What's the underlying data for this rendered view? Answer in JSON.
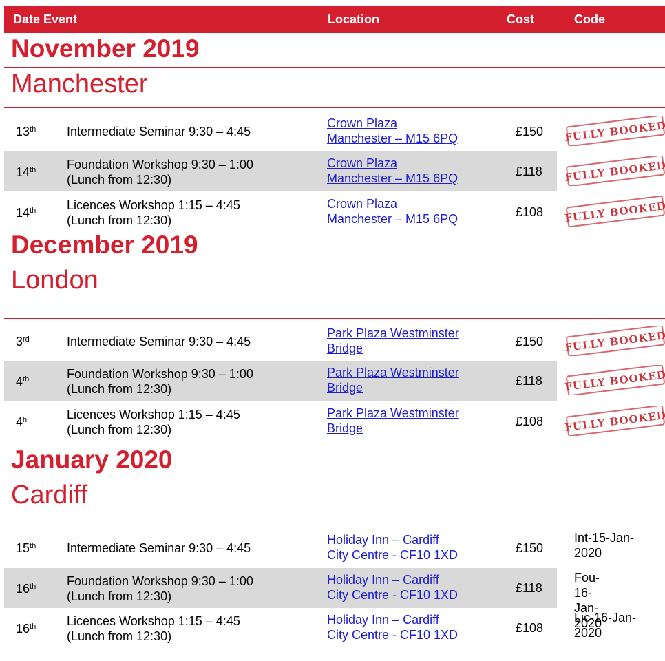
{
  "header": {
    "date_event": "Date Event",
    "location": "Location",
    "cost": "Cost",
    "code": "Code"
  },
  "colors": {
    "brand_red": "#d31f2e",
    "row_shade": "#d9d9d9",
    "link_blue": "#1f1fd0"
  },
  "stamp_text": "FULLY BOOKED",
  "sections": [
    {
      "month": "November 2019",
      "city": "Manchester",
      "rows": [
        {
          "day": "13",
          "suffix": "th",
          "event": [
            "Intermediate Seminar 9:30 – 4:45"
          ],
          "location": [
            "Crown Plaza",
            "Manchester – M15 6PQ"
          ],
          "cost": "£150",
          "status": "FULLY BOOKED"
        },
        {
          "day": "14",
          "suffix": "th",
          "event": [
            "Foundation Workshop 9:30 – 1:00",
            "(Lunch from 12:30)"
          ],
          "location": [
            "Crown Plaza",
            "Manchester – M15 6PQ"
          ],
          "cost": "£118",
          "status": "FULLY BOOKED"
        },
        {
          "day": "14",
          "suffix": "th",
          "event": [
            "Licences Workshop 1:15 – 4:45",
            "(Lunch from 12:30)"
          ],
          "location": [
            "Crown Plaza",
            "Manchester – M15 6PQ"
          ],
          "cost": "£108",
          "status": "FULLY BOOKED"
        }
      ]
    },
    {
      "month": "December 2019",
      "city": "London",
      "rows": [
        {
          "day": "3",
          "suffix": "rd",
          "event": [
            "Intermediate Seminar 9:30 – 4:45"
          ],
          "location": [
            "Park Plaza Westminster",
            "Bridge"
          ],
          "cost": "£150",
          "status": "FULLY BOOKED"
        },
        {
          "day": "4",
          "suffix": "th",
          "event": [
            "Foundation Workshop 9:30 – 1:00",
            "(Lunch from 12:30)"
          ],
          "location": [
            "Park Plaza Westminster",
            "Bridge"
          ],
          "cost": "£118",
          "status": "FULLY BOOKED"
        },
        {
          "day": "4",
          "suffix": "h",
          "event": [
            "Licences Workshop 1:15 – 4:45",
            "(Lunch from 12:30)"
          ],
          "location": [
            "Park Plaza Westminster",
            "Bridge"
          ],
          "cost": "£108",
          "status": "FULLY BOOKED"
        }
      ]
    },
    {
      "month": "January 2020",
      "city": "Cardiff",
      "rows": [
        {
          "day": "15",
          "suffix": "th",
          "event": [
            "Intermediate Seminar 9:30 – 4:45"
          ],
          "location": [
            "Holiday Inn – Cardiff",
            "City Centre - CF10 1XD"
          ],
          "cost": "£150",
          "code": [
            "Int-15-Jan-",
            "2020"
          ]
        },
        {
          "day": "16",
          "suffix": "th",
          "event": [
            "Foundation Workshop 9:30 – 1:00",
            "(Lunch from 12:30)"
          ],
          "location": [
            "Holiday Inn – Cardiff",
            "City Centre - CF10 1XD"
          ],
          "cost": "£118",
          "code": [
            "Fou-16-Jan-",
            "2020"
          ]
        },
        {
          "day": "16",
          "suffix": "th",
          "event": [
            "Licences Workshop 1:15 – 4:45",
            "(Lunch from 12:30)"
          ],
          "location": [
            "Holiday Inn – Cardiff",
            "City Centre - CF10 1XD"
          ],
          "cost": "£108",
          "code": [
            "Lic-16-Jan-",
            "2020"
          ]
        }
      ]
    }
  ]
}
